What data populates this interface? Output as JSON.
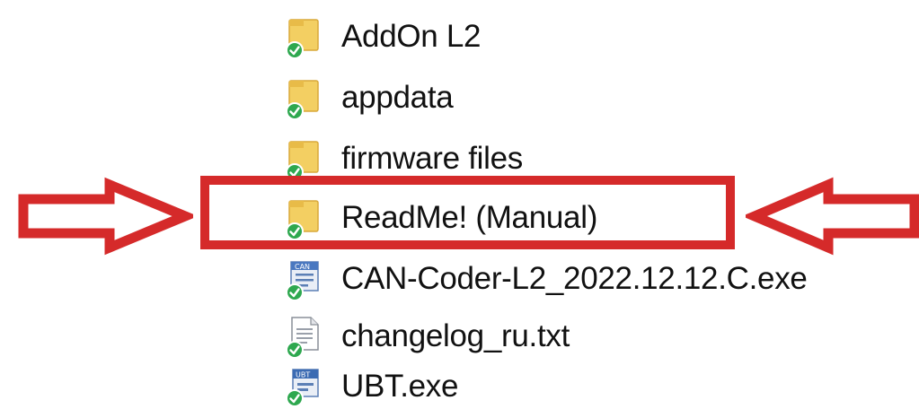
{
  "files": [
    {
      "name": "AddOn L2",
      "icon": "folder-icon",
      "sync": "synced"
    },
    {
      "name": "appdata",
      "icon": "folder-icon",
      "sync": "synced"
    },
    {
      "name": "firmware files",
      "icon": "folder-icon",
      "sync": "synced"
    },
    {
      "name": "ReadMe! (Manual)",
      "icon": "folder-icon",
      "sync": "synced",
      "highlighted": true
    },
    {
      "name": "CAN-Coder-L2_2022.12.12.C.exe",
      "icon": "can-exe-icon",
      "sync": "synced"
    },
    {
      "name": "changelog_ru.txt",
      "icon": "text-file-icon",
      "sync": "synced"
    },
    {
      "name": "UBT.exe",
      "icon": "ubt-exe-icon",
      "sync": "synced"
    }
  ],
  "annotation": {
    "color": "#d52a2a"
  },
  "colors": {
    "folder": "#f3cf62",
    "sync_check": "#2ea84f"
  }
}
